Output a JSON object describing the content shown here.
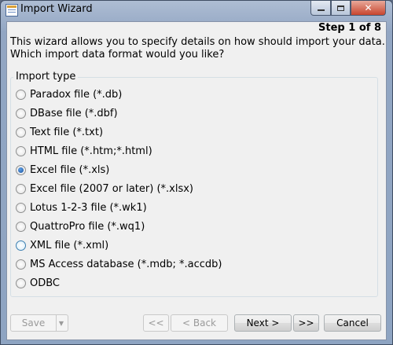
{
  "window": {
    "title": "Import Wizard",
    "close_glyph": "✕"
  },
  "wizard": {
    "step": "Step 1 of 8",
    "intro_line1": "This wizard allows you to specify details on how should import your data.",
    "intro_line2": "Which import data format would you like?"
  },
  "import_type": {
    "legend": "Import type",
    "selected_index": 4,
    "options": [
      "Paradox file (*.db)",
      "DBase file (*.dbf)",
      "Text file (*.txt)",
      "HTML file (*.htm;*.html)",
      "Excel file (*.xls)",
      "Excel file (2007 or later) (*.xlsx)",
      "Lotus 1-2-3 file (*.wk1)",
      "QuattroPro file (*.wq1)",
      "XML file (*.xml)",
      "MS Access database (*.mdb; *.accdb)",
      "ODBC"
    ]
  },
  "footer": {
    "save": "Save",
    "save_arrow": "▼",
    "first": "<<",
    "back": "< Back",
    "next": "Next >",
    "last": ">>",
    "cancel": "Cancel"
  }
}
